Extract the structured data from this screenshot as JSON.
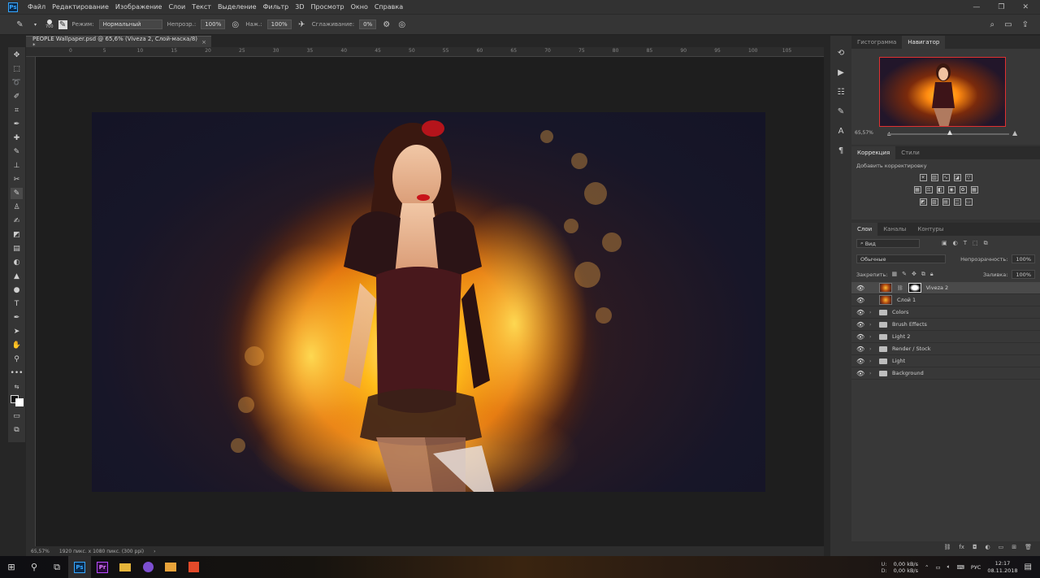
{
  "app": {
    "logo": "Ps"
  },
  "menu": [
    "Файл",
    "Редактирование",
    "Изображение",
    "Слои",
    "Текст",
    "Выделение",
    "Фильтр",
    "3D",
    "Просмотр",
    "Окно",
    "Справка"
  ],
  "window_controls": [
    "—",
    "❐",
    "✕"
  ],
  "options_bar": {
    "brush_size": "700",
    "mode_label": "Режим:",
    "mode_value": "Нормальный",
    "opacity_label": "Непрозр.:",
    "opacity_value": "100%",
    "flow_label": "Наж.:",
    "flow_value": "100%",
    "smoothing_label": "Сглаживание:",
    "smoothing_value": "0%"
  },
  "document_tab": {
    "title": "PEOPLE Wallpaper.psd @ 65,6% (Viveza 2, Слой-маска/8) *",
    "close": "×"
  },
  "ruler_ticks": [
    "0",
    "5",
    "10",
    "15",
    "20",
    "25",
    "30",
    "35",
    "40",
    "45",
    "50",
    "55",
    "60",
    "65",
    "70",
    "75",
    "80",
    "85",
    "90",
    "95",
    "100",
    "105"
  ],
  "status_bar": {
    "zoom": "65,57%",
    "doc_info": "1920 пикс. x 1080 пикс. (300 ppi)",
    "arrow": "›"
  },
  "navigator": {
    "tabs": [
      "Гистограмма",
      "Навигатор"
    ],
    "active_tab": "Навигатор",
    "zoom": "65,57%"
  },
  "adjustments": {
    "tabs": [
      "Коррекция",
      "Стили"
    ],
    "hint": "Добавить корректировку"
  },
  "layers_panel": {
    "tabs": [
      "Слои",
      "Каналы",
      "Контуры"
    ],
    "filter_label": "Вид",
    "blend_mode": "Обычные",
    "opacity_label": "Непрозрачность:",
    "opacity_value": "100%",
    "lock_label": "Закрепить:",
    "fill_label": "Заливка:",
    "fill_value": "100%",
    "layers": [
      {
        "name": "Viveza 2",
        "type": "smart",
        "selected": true
      },
      {
        "name": "Слой 1",
        "type": "pixel",
        "selected": false
      },
      {
        "name": "Colors",
        "type": "group",
        "selected": false
      },
      {
        "name": "Brush Effects",
        "type": "group",
        "selected": false
      },
      {
        "name": "Light 2",
        "type": "group",
        "selected": false
      },
      {
        "name": "Render / Stock",
        "type": "group",
        "selected": false
      },
      {
        "name": "Light",
        "type": "group",
        "selected": false
      },
      {
        "name": "Background",
        "type": "group",
        "selected": false
      }
    ],
    "footer_icons": [
      "link-icon",
      "fx-icon",
      "mask-icon",
      "adjustment-icon",
      "folder-icon",
      "new-layer-icon",
      "trash-icon"
    ]
  },
  "taskbar": {
    "apps": [
      "Ps",
      "Pr"
    ],
    "net_up": "0,00 kB/s",
    "net_down": "0,00 kB/s",
    "net_labels": [
      "U:",
      "D:"
    ],
    "lang": "РУС",
    "time": "12:17",
    "date": "08.11.2018"
  }
}
